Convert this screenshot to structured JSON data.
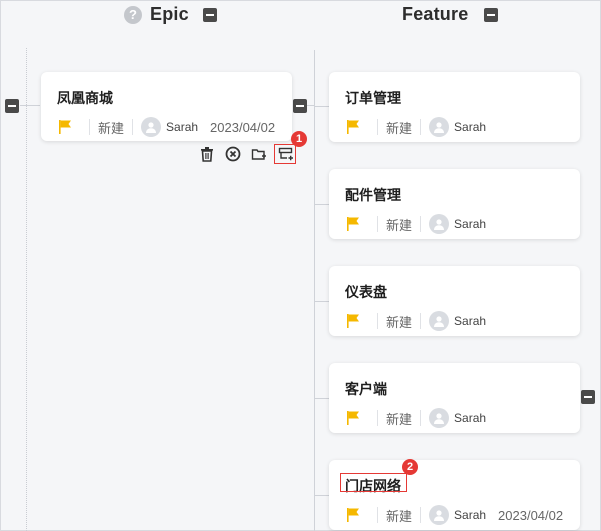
{
  "columns": {
    "epic": {
      "title": "Epic",
      "help_icon": "question-circle-icon"
    },
    "feature": {
      "title": "Feature"
    }
  },
  "epic_card": {
    "title": "凤凰商城",
    "status": "新建",
    "user": "Sarah",
    "date": "2023/04/02"
  },
  "toolbar": {
    "icons": [
      "trash-icon",
      "close-circle-icon",
      "add-child-icon",
      "add-sibling-icon"
    ]
  },
  "feature_cards": [
    {
      "title": "订单管理",
      "status": "新建",
      "user": "Sarah",
      "date": ""
    },
    {
      "title": "配件管理",
      "status": "新建",
      "user": "Sarah",
      "date": ""
    },
    {
      "title": "仪表盘",
      "status": "新建",
      "user": "Sarah",
      "date": ""
    },
    {
      "title": "客户端",
      "status": "新建",
      "user": "Sarah",
      "date": ""
    },
    {
      "title": "门店网络",
      "status": "新建",
      "user": "Sarah",
      "date": "2023/04/02"
    }
  ],
  "callouts": {
    "one": "1",
    "two": "2"
  },
  "colors": {
    "flag": "#f5b800",
    "callout": "#e53935",
    "collapse": "#4a4a4a"
  }
}
